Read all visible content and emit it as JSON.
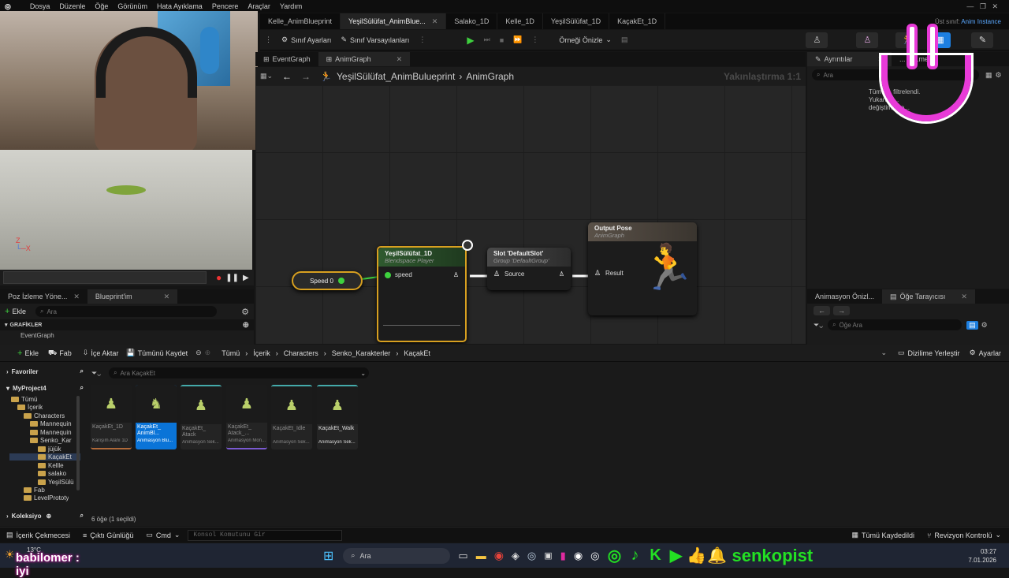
{
  "menu": [
    "Dosya",
    "Düzenle",
    "Öğe",
    "Görünüm",
    "Hata Ayıklama",
    "Pencere",
    "Araçlar",
    "Yardım"
  ],
  "doc_tabs": [
    {
      "label": "Kelle_AnimBlueprint",
      "active": false
    },
    {
      "label": "YeşilSülüfat_AnimBlue...",
      "active": true
    },
    {
      "label": "Salako_1D",
      "active": false
    },
    {
      "label": "Kelle_1D",
      "active": false
    },
    {
      "label": "YeşilSülüfat_1D",
      "active": false
    },
    {
      "label": "KaçakEt_1D",
      "active": false
    }
  ],
  "parent_class": {
    "label": "Üst sınıf:",
    "value": "Anim Instance"
  },
  "toolbar": {
    "class_settings": "Sınıf Ayarları",
    "class_defaults": "Sınıf Varsayılanları",
    "preview_instance": "Örneği Önizle"
  },
  "graph_tabs": [
    "EventGraph",
    "AnimGraph"
  ],
  "breadcrumb": {
    "blueprint": "YeşilSülüfat_AnimBulueprint",
    "graph": "AnimGraph",
    "zoom": "Yakınlaştırma 1:1"
  },
  "details": {
    "tab1": "Ayrıntılar",
    "tab2": "... Ö...me...",
    "search_placeholder": "Ara",
    "msg_line1": "Tüm s... filtrelendi.",
    "msg_line2": "Yukarıda...",
    "msg_line3": "değiştirmeye..."
  },
  "nodes": {
    "speed_var": "Speed 0",
    "blendspace": {
      "title": "YeşilSülüfat_1D",
      "subtitle": "Blendspace Player",
      "pin": "speed"
    },
    "slot": {
      "title": "Slot 'DefaultSlot'",
      "subtitle": "Group 'DefaultGroup'",
      "pin": "Source"
    },
    "output": {
      "title": "Output Pose",
      "subtitle": "AnimGraph",
      "pin": "Result"
    }
  },
  "left_panel": {
    "tab1": "Poz İzleme Yöne...",
    "tab2": "Blueprint'im",
    "add": "Ekle",
    "search_placeholder": "Ara",
    "section": "GRAFİKLER",
    "item": "EventGraph"
  },
  "right_lower": {
    "tab1": "Animasyon Önizl...",
    "tab2": "Öğe Tarayıcısı",
    "search_placeholder": "Öğe Ara"
  },
  "content_browser": {
    "add": "Ekle",
    "fab": "Fab",
    "import": "İçe Aktar",
    "save_all": "Tümünü Kaydet",
    "path": [
      "Tümü",
      "İçerik",
      "Characters",
      "Senko_Karakterler",
      "KaçakEt"
    ],
    "dock": "Dizilime Yerleştir",
    "settings": "Ayarlar",
    "favorites": "Favoriler",
    "project": "MyProject4",
    "search_placeholder": "Ara KaçakEt",
    "collections": "Koleksiyo",
    "count": "6 öğe (1 seçildi)",
    "tree": [
      "Tümü",
      "İçerik",
      "Characters",
      "Mannequin",
      "Mannequin",
      "Senko_Kar",
      "jüjük",
      "KaçakEt",
      "Kellle",
      "salako",
      "YeşilSülü",
      "Fab",
      "LevelPrototy"
    ],
    "assets": [
      {
        "name": "KaçakEt_1D",
        "type": "Karışım Alanı 1D",
        "selected": false
      },
      {
        "name": "KaçakEt_ AnimBl...",
        "type": "Animasyon Blu...",
        "selected": true
      },
      {
        "name": "KaçakEt_ Atack",
        "type": "Animasyon Sek...",
        "selected": false
      },
      {
        "name": "KaçakEt_ Atack_...",
        "type": "Animasyon Mon...",
        "selected": false
      },
      {
        "name": "KaçakEt_Idle",
        "type": "Animasyon Sek...",
        "selected": false
      },
      {
        "name": "KaçakEt_Walk",
        "type": "Animasyon Sek...",
        "selected": false
      }
    ]
  },
  "status": {
    "drawer": "İçerik Çekmecesi",
    "log": "Çıktı Günlüğü",
    "cmd": "Cmd",
    "console_placeholder": "Konsol Komutunu Gir",
    "saved": "Tümü Kaydedildi",
    "revision": "Revizyon Kontrolü"
  },
  "taskbar": {
    "temp": "13°C",
    "overlay": "babilomer : iyi",
    "search": "Ara",
    "brand": "senkopist",
    "time": "03:27",
    "date": "7.01.2026"
  }
}
